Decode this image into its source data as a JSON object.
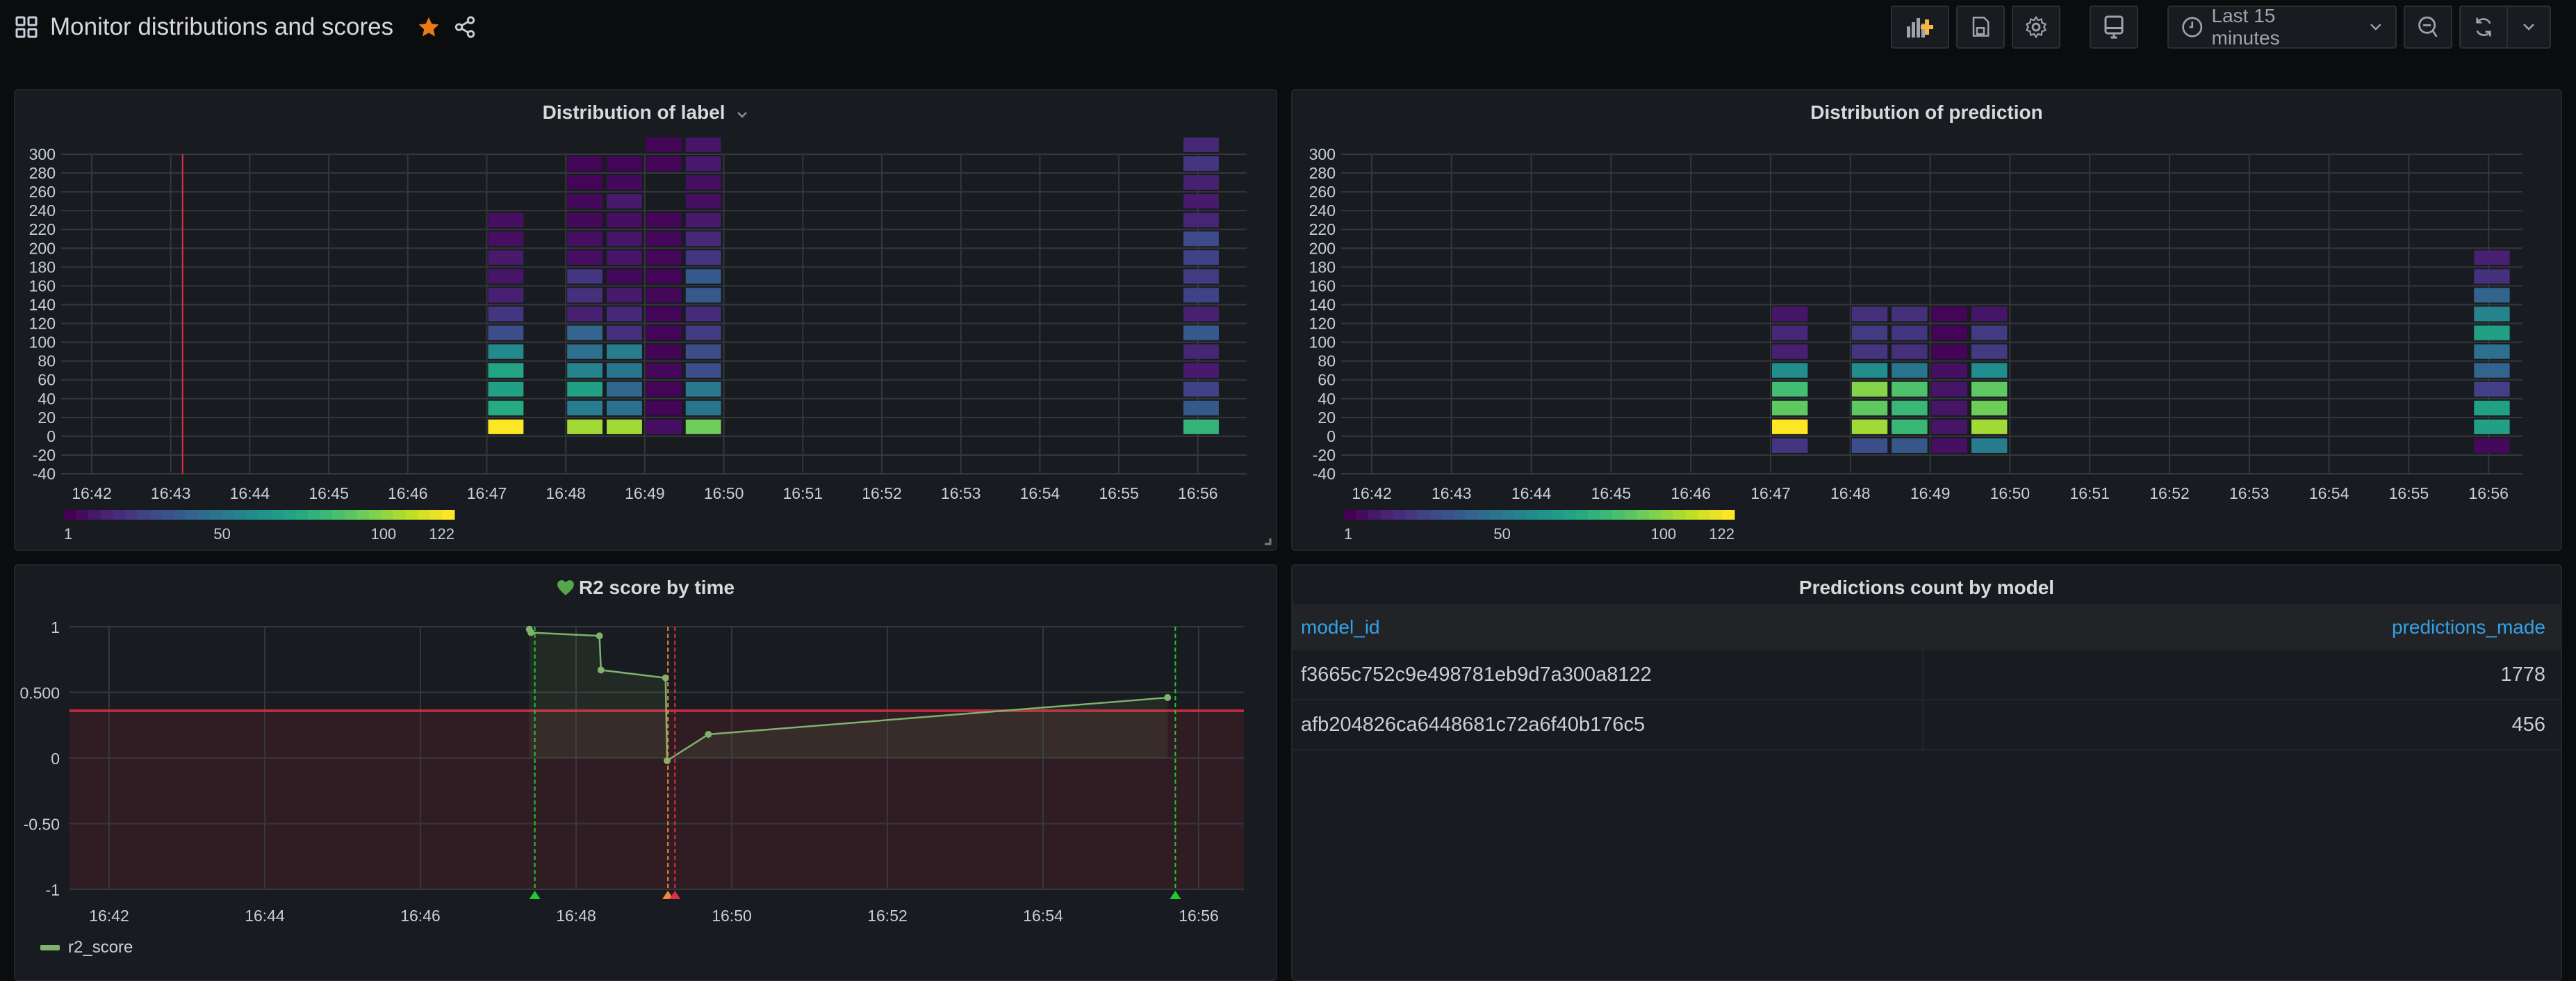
{
  "header": {
    "title": "Monitor distributions and scores",
    "icons": [
      "dashboard-grid-icon",
      "star-icon",
      "share-icon"
    ],
    "star_color": "#eb7b18"
  },
  "toolbar": {
    "add_panel": "add-panel-icon",
    "save": "save-icon",
    "settings": "gear-icon",
    "tv_mode": "monitor-icon",
    "time_range_label": "Last 15 minutes",
    "zoom_out": "zoom-out-icon",
    "refresh": "refresh-icon",
    "refresh_menu": "chevron-down-icon"
  },
  "panels": {
    "label": {
      "title": "Distribution of label",
      "menu_icon": "chevron-down-icon"
    },
    "prediction": {
      "title": "Distribution of prediction"
    },
    "r2": {
      "title": "R2 score by time",
      "status_icon": "heart-icon",
      "status_color": "#56a64b",
      "legend": "r2_score"
    },
    "table": {
      "title": "Predictions count by model",
      "columns": [
        "model_id",
        "predictions_made"
      ],
      "rows": [
        {
          "model_id": "f3665c752c9e498781eb9d7a300a8122",
          "predictions_made": "1778"
        },
        {
          "model_id": "afb204826ca6448681c72a6f40b176c5",
          "predictions_made": "456"
        }
      ]
    }
  },
  "chart_data": [
    {
      "type": "heatmap",
      "title": "Distribution of label",
      "x_ticks": [
        "16:42",
        "16:43",
        "16:44",
        "16:45",
        "16:46",
        "16:47",
        "16:48",
        "16:49",
        "16:50",
        "16:51",
        "16:52",
        "16:53",
        "16:54",
        "16:55",
        "16:56"
      ],
      "y_ticks": [
        300,
        280,
        260,
        240,
        220,
        200,
        180,
        160,
        140,
        120,
        100,
        80,
        60,
        40,
        20,
        0,
        -20,
        -40
      ],
      "ylim": [
        -40,
        300
      ],
      "x_range_min": [
        0,
        14.6
      ],
      "bucket_size_y": 20,
      "color_scale": {
        "min": 1,
        "max": 122,
        "ticks": [
          1,
          50,
          100,
          122
        ],
        "scheme": "viridis"
      },
      "annotation_x_min": 1.15,
      "columns": [
        {
          "x_min": 5.0,
          "y_start": 0,
          "counts": [
            122,
            75,
            70,
            72,
            58,
            30,
            20,
            12,
            8,
            10,
            6,
            6
          ]
        },
        {
          "x_min": 6.0,
          "y_start": 0,
          "counts": [
            105,
            52,
            70,
            55,
            45,
            40,
            12,
            18,
            20,
            6,
            6,
            4,
            4,
            2,
            2
          ]
        },
        {
          "x_min": 6.5,
          "y_start": 0,
          "counts": [
            105,
            45,
            42,
            48,
            52,
            18,
            15,
            10,
            4,
            8,
            8,
            6,
            10,
            4,
            2
          ]
        },
        {
          "x_min": 7.0,
          "y_start": 0,
          "counts": [
            6,
            2,
            2,
            3,
            2,
            2,
            2,
            3,
            2,
            3,
            3,
            2,
            0,
            0,
            2,
            2
          ]
        },
        {
          "x_min": 7.5,
          "y_start": 0,
          "counts": [
            95,
            48,
            50,
            30,
            30,
            22,
            16,
            35,
            35,
            20,
            15,
            10,
            6,
            6,
            10,
            8
          ]
        },
        {
          "x_min": 13.8,
          "y_start": 0,
          "counts": [
            80,
            35,
            25,
            10,
            14,
            35,
            12,
            25,
            22,
            25,
            28,
            14,
            10,
            12,
            20,
            15
          ]
        }
      ]
    },
    {
      "type": "heatmap",
      "title": "Distribution of prediction",
      "x_ticks": [
        "16:42",
        "16:43",
        "16:44",
        "16:45",
        "16:46",
        "16:47",
        "16:48",
        "16:49",
        "16:50",
        "16:51",
        "16:52",
        "16:53",
        "16:54",
        "16:55",
        "16:56"
      ],
      "y_ticks": [
        300,
        280,
        260,
        240,
        220,
        200,
        180,
        160,
        140,
        120,
        100,
        80,
        60,
        40,
        20,
        0,
        -20,
        -40
      ],
      "ylim": [
        -40,
        300
      ],
      "bucket_size_y": 20,
      "color_scale": {
        "min": 1,
        "max": 122,
        "ticks": [
          1,
          50,
          100,
          122
        ],
        "scheme": "viridis"
      },
      "columns": [
        {
          "x_min": 5.0,
          "y_start": -20,
          "counts": [
            20,
            122,
            92,
            85,
            60,
            12,
            15,
            8
          ]
        },
        {
          "x_min": 6.0,
          "y_start": -20,
          "counts": [
            30,
            105,
            92,
            100,
            60,
            20,
            22,
            18
          ]
        },
        {
          "x_min": 6.5,
          "y_start": -20,
          "counts": [
            34,
            82,
            82,
            88,
            48,
            18,
            20,
            18
          ]
        },
        {
          "x_min": 7.0,
          "y_start": -20,
          "counts": [
            6,
            8,
            8,
            8,
            6,
            2,
            2,
            2
          ]
        },
        {
          "x_min": 7.5,
          "y_start": -20,
          "counts": [
            52,
            105,
            95,
            92,
            60,
            22,
            22,
            8
          ]
        },
        {
          "x_min": 13.8,
          "y_start": -20,
          "counts": [
            4,
            70,
            70,
            24,
            40,
            45,
            70,
            55,
            40,
            18,
            12
          ]
        }
      ]
    },
    {
      "type": "line",
      "title": "R2 score by time",
      "x_ticks": [
        "16:42",
        "16:44",
        "16:46",
        "16:48",
        "16:50",
        "16:52",
        "16:54",
        "16:56"
      ],
      "y_ticks": [
        "1",
        "0.500",
        "0",
        "-0.50",
        "-1"
      ],
      "ylim": [
        -1,
        1
      ],
      "series": [
        {
          "name": "r2_score",
          "color": "#7eb26d",
          "x_min": [
            5.4,
            5.42,
            6.3,
            6.32,
            7.15,
            7.17,
            7.7,
            13.6
          ],
          "values": [
            0.98,
            0.955,
            0.93,
            0.67,
            0.61,
            -0.02,
            0.18,
            0.46
          ]
        }
      ],
      "threshold": {
        "value": 0.36,
        "color": "#e02f44",
        "fill": "below"
      },
      "annotations": [
        {
          "x_min": 5.47,
          "color": "#1fc92e"
        },
        {
          "x_min": 7.18,
          "color": "#f2893a"
        },
        {
          "x_min": 7.27,
          "color": "#e02f44"
        },
        {
          "x_min": 13.7,
          "color": "#1fc92e"
        }
      ]
    }
  ]
}
